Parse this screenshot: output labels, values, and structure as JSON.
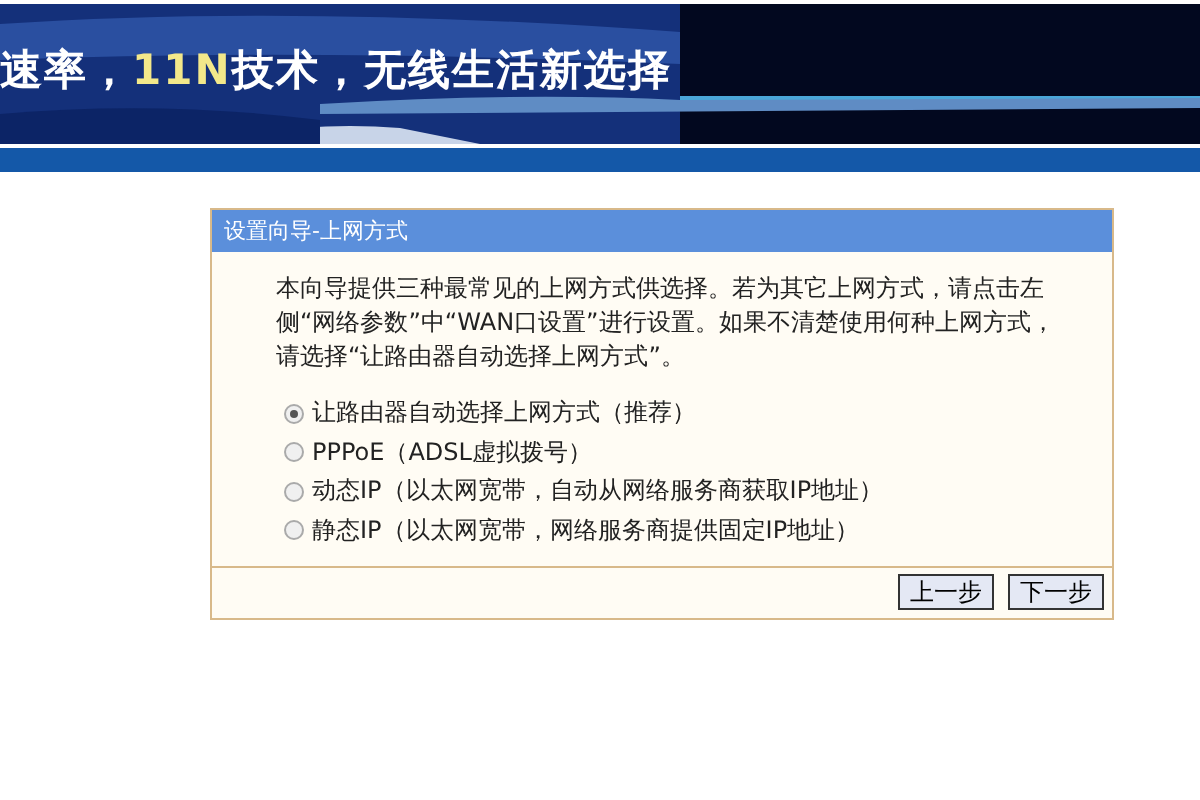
{
  "banner": {
    "slogan": [
      {
        "text": "速率，",
        "highlight": false
      },
      {
        "text": "11N",
        "highlight": true
      },
      {
        "text": "技术，无线生活新选择",
        "highlight": false
      }
    ]
  },
  "panel": {
    "title": "设置向导-上网方式",
    "intro": "本向导提供三种最常见的上网方式供选择。若为其它上网方式，请点击左侧“网络参数”中“WAN口设置”进行设置。如果不清楚使用何种上网方式，请选择“让路由器自动选择上网方式”。",
    "options": [
      {
        "label": "让路由器自动选择上网方式（推荐）",
        "selected": true
      },
      {
        "label": "PPPoE（ADSL虚拟拨号）",
        "selected": false
      },
      {
        "label": "动态IP（以太网宽带，自动从网络服务商获取IP地址）",
        "selected": false
      },
      {
        "label": "静态IP（以太网宽带，网络服务商提供固定IP地址）",
        "selected": false
      }
    ],
    "buttons": [
      "上一步",
      "下一步"
    ]
  }
}
